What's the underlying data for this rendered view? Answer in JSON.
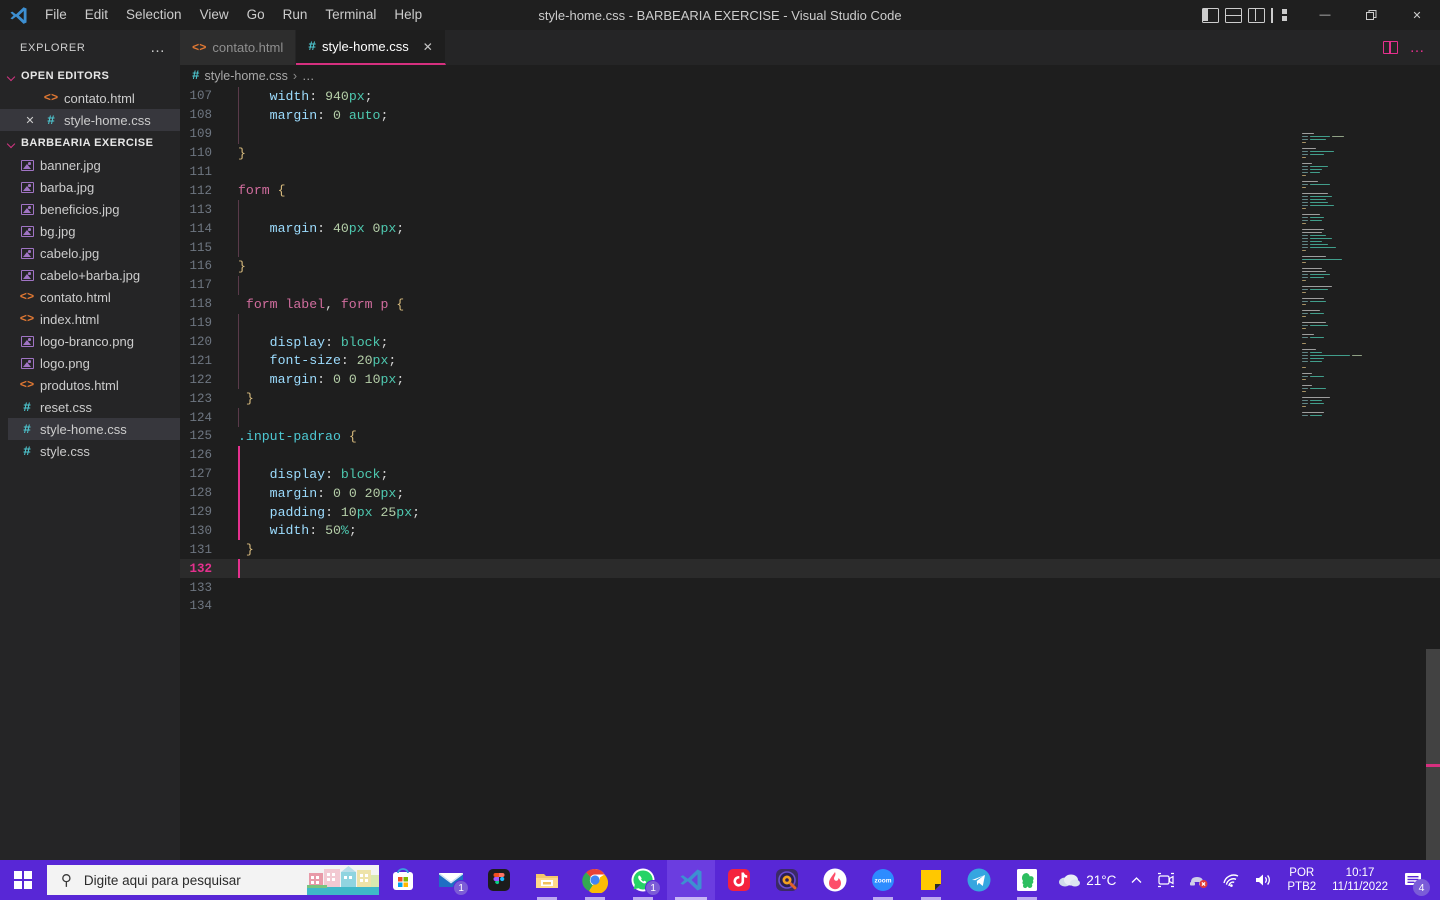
{
  "window": {
    "title": "style-home.css - BARBEARIA EXERCISE - Visual Studio Code",
    "menu": [
      "File",
      "Edit",
      "Selection",
      "View",
      "Go",
      "Run",
      "Terminal",
      "Help"
    ],
    "minimize_label": "—",
    "maximize_label": "❐",
    "close_label": "✕",
    "layout_icons": [
      "toggle-primary-sidebar-icon",
      "toggle-panel-icon",
      "toggle-secondary-sidebar-icon",
      "customize-layout-icon"
    ]
  },
  "sidebar": {
    "header": "EXPLORER",
    "more_actions": "…",
    "open_editors": {
      "label": "OPEN EDITORS",
      "items": [
        {
          "name": "contato.html",
          "icon": "html-file-icon",
          "dirty": false,
          "active": false
        },
        {
          "name": "style-home.css",
          "icon": "css-file-icon",
          "dirty": false,
          "active": true
        }
      ]
    },
    "project": {
      "label": "BARBEARIA EXERCISE",
      "files": [
        {
          "name": "banner.jpg",
          "icon": "image-file-icon"
        },
        {
          "name": "barba.jpg",
          "icon": "image-file-icon"
        },
        {
          "name": "beneficios.jpg",
          "icon": "image-file-icon"
        },
        {
          "name": "bg.jpg",
          "icon": "image-file-icon"
        },
        {
          "name": "cabelo.jpg",
          "icon": "image-file-icon"
        },
        {
          "name": "cabelo+barba.jpg",
          "icon": "image-file-icon"
        },
        {
          "name": "contato.html",
          "icon": "html-file-icon"
        },
        {
          "name": "index.html",
          "icon": "html-file-icon"
        },
        {
          "name": "logo-branco.png",
          "icon": "image-file-icon"
        },
        {
          "name": "logo.png",
          "icon": "image-file-icon"
        },
        {
          "name": "produtos.html",
          "icon": "html-file-icon"
        },
        {
          "name": "reset.css",
          "icon": "css-file-icon"
        },
        {
          "name": "style-home.css",
          "icon": "css-file-icon",
          "selected": true
        },
        {
          "name": "style.css",
          "icon": "css-file-icon"
        }
      ]
    }
  },
  "editor": {
    "tabs": [
      {
        "label": "contato.html",
        "icon": "html-file-icon",
        "active": false
      },
      {
        "label": "style-home.css",
        "icon": "css-file-icon",
        "active": true,
        "close": "✕"
      }
    ],
    "actions": {
      "split_editor": "split-editor-icon",
      "more": "…"
    },
    "breadcrumb": {
      "icon": "css-file-icon",
      "file": "style-home.css",
      "separator": "›",
      "tail": "…"
    },
    "first_line_number": 107,
    "active_line": 132,
    "lines": [
      {
        "n": 107,
        "tokens": [
          {
            "t": "    ",
            "c": "punc"
          },
          {
            "t": "width",
            "c": "prop"
          },
          {
            "t": ": ",
            "c": "punc"
          },
          {
            "t": "940",
            "c": "num"
          },
          {
            "t": "px",
            "c": "val"
          },
          {
            "t": ";",
            "c": "punc"
          }
        ],
        "guide": true
      },
      {
        "n": 108,
        "tokens": [
          {
            "t": "    ",
            "c": "punc"
          },
          {
            "t": "margin",
            "c": "prop"
          },
          {
            "t": ": ",
            "c": "punc"
          },
          {
            "t": "0",
            "c": "num"
          },
          {
            "t": " ",
            "c": "punc"
          },
          {
            "t": "auto",
            "c": "val"
          },
          {
            "t": ";",
            "c": "punc"
          }
        ],
        "guide": true
      },
      {
        "n": 109,
        "tokens": [],
        "guide": true
      },
      {
        "n": 110,
        "tokens": [
          {
            "t": "}",
            "c": "brace"
          }
        ],
        "guide": false
      },
      {
        "n": 111,
        "tokens": [],
        "guide": false
      },
      {
        "n": 112,
        "tokens": [
          {
            "t": "form",
            "c": "sel"
          },
          {
            "t": " ",
            "c": "punc"
          },
          {
            "t": "{",
            "c": "brace"
          }
        ],
        "guide": false
      },
      {
        "n": 113,
        "tokens": [],
        "guide": true
      },
      {
        "n": 114,
        "tokens": [
          {
            "t": "    ",
            "c": "punc"
          },
          {
            "t": "margin",
            "c": "prop"
          },
          {
            "t": ": ",
            "c": "punc"
          },
          {
            "t": "40",
            "c": "num"
          },
          {
            "t": "px",
            "c": "val"
          },
          {
            "t": " ",
            "c": "punc"
          },
          {
            "t": "0",
            "c": "num"
          },
          {
            "t": "px",
            "c": "val"
          },
          {
            "t": ";",
            "c": "punc"
          }
        ],
        "guide": true
      },
      {
        "n": 115,
        "tokens": [],
        "guide": true
      },
      {
        "n": 116,
        "tokens": [
          {
            "t": "}",
            "c": "brace"
          }
        ],
        "guide": false
      },
      {
        "n": 117,
        "tokens": [],
        "guide": true
      },
      {
        "n": 118,
        "tokens": [
          {
            "t": " form label",
            "c": "sel"
          },
          {
            "t": ", ",
            "c": "punc"
          },
          {
            "t": "form p",
            "c": "sel"
          },
          {
            "t": " ",
            "c": "punc"
          },
          {
            "t": "{",
            "c": "brace"
          }
        ],
        "guide": false
      },
      {
        "n": 119,
        "tokens": [],
        "guide": true
      },
      {
        "n": 120,
        "tokens": [
          {
            "t": "    ",
            "c": "punc"
          },
          {
            "t": "display",
            "c": "prop"
          },
          {
            "t": ": ",
            "c": "punc"
          },
          {
            "t": "block",
            "c": "val"
          },
          {
            "t": ";",
            "c": "punc"
          }
        ],
        "guide": true
      },
      {
        "n": 121,
        "tokens": [
          {
            "t": "    ",
            "c": "punc"
          },
          {
            "t": "font-size",
            "c": "prop"
          },
          {
            "t": ": ",
            "c": "punc"
          },
          {
            "t": "20",
            "c": "num"
          },
          {
            "t": "px",
            "c": "val"
          },
          {
            "t": ";",
            "c": "punc"
          }
        ],
        "guide": true
      },
      {
        "n": 122,
        "tokens": [
          {
            "t": "    ",
            "c": "punc"
          },
          {
            "t": "margin",
            "c": "prop"
          },
          {
            "t": ": ",
            "c": "punc"
          },
          {
            "t": "0",
            "c": "num"
          },
          {
            "t": " ",
            "c": "punc"
          },
          {
            "t": "0",
            "c": "num"
          },
          {
            "t": " ",
            "c": "punc"
          },
          {
            "t": "10",
            "c": "num"
          },
          {
            "t": "px",
            "c": "val"
          },
          {
            "t": ";",
            "c": "punc"
          }
        ],
        "guide": true
      },
      {
        "n": 123,
        "tokens": [
          {
            "t": " }",
            "c": "brace"
          }
        ],
        "guide": false
      },
      {
        "n": 124,
        "tokens": [],
        "guide": true
      },
      {
        "n": 125,
        "tokens": [
          {
            "t": ".input-padrao",
            "c": "cls"
          },
          {
            "t": " ",
            "c": "punc"
          },
          {
            "t": "{",
            "c": "brace"
          }
        ],
        "guide": false
      },
      {
        "n": 126,
        "tokens": [],
        "guide": "active"
      },
      {
        "n": 127,
        "tokens": [
          {
            "t": "    ",
            "c": "punc"
          },
          {
            "t": "display",
            "c": "prop"
          },
          {
            "t": ": ",
            "c": "punc"
          },
          {
            "t": "block",
            "c": "val"
          },
          {
            "t": ";",
            "c": "punc"
          }
        ],
        "guide": "active"
      },
      {
        "n": 128,
        "tokens": [
          {
            "t": "    ",
            "c": "punc"
          },
          {
            "t": "margin",
            "c": "prop"
          },
          {
            "t": ": ",
            "c": "punc"
          },
          {
            "t": "0",
            "c": "num"
          },
          {
            "t": " ",
            "c": "punc"
          },
          {
            "t": "0",
            "c": "num"
          },
          {
            "t": " ",
            "c": "punc"
          },
          {
            "t": "20",
            "c": "num"
          },
          {
            "t": "px",
            "c": "val"
          },
          {
            "t": ";",
            "c": "punc"
          }
        ],
        "guide": "active"
      },
      {
        "n": 129,
        "tokens": [
          {
            "t": "    ",
            "c": "punc"
          },
          {
            "t": "padding",
            "c": "prop"
          },
          {
            "t": ": ",
            "c": "punc"
          },
          {
            "t": "10",
            "c": "num"
          },
          {
            "t": "px",
            "c": "val"
          },
          {
            "t": " ",
            "c": "punc"
          },
          {
            "t": "25",
            "c": "num"
          },
          {
            "t": "px",
            "c": "val"
          },
          {
            "t": ";",
            "c": "punc"
          }
        ],
        "guide": "active"
      },
      {
        "n": 130,
        "tokens": [
          {
            "t": "    ",
            "c": "punc"
          },
          {
            "t": "width",
            "c": "prop"
          },
          {
            "t": ": ",
            "c": "punc"
          },
          {
            "t": "50",
            "c": "num"
          },
          {
            "t": "%",
            "c": "val"
          },
          {
            "t": ";",
            "c": "punc"
          }
        ],
        "guide": "active"
      },
      {
        "n": 131,
        "tokens": [
          {
            "t": " }",
            "c": "brace"
          }
        ],
        "guide": false
      },
      {
        "n": 132,
        "tokens": [],
        "guide": "active",
        "current": true
      },
      {
        "n": 133,
        "tokens": [],
        "guide": false
      },
      {
        "n": 134,
        "tokens": [],
        "guide": false
      }
    ]
  },
  "taskbar": {
    "start": "windows-start-icon",
    "search_placeholder": "Digite aqui para pesquisar",
    "apps": [
      {
        "name": "microsoft-store-icon",
        "badge": null,
        "active": false,
        "open": false
      },
      {
        "name": "mail-icon",
        "badge": "1",
        "active": false,
        "open": false
      },
      {
        "name": "figma-icon",
        "badge": null,
        "active": false,
        "open": false
      },
      {
        "name": "file-explorer-icon",
        "badge": null,
        "active": false,
        "open": true
      },
      {
        "name": "google-chrome-icon",
        "badge": null,
        "active": false,
        "open": true
      },
      {
        "name": "whatsapp-icon",
        "badge": "1",
        "active": false,
        "open": true
      },
      {
        "name": "visual-studio-code-icon",
        "badge": null,
        "active": true,
        "open": true
      },
      {
        "name": "tiktok-icon",
        "badge": null,
        "active": false,
        "open": false
      },
      {
        "name": "spotify-like-icon",
        "badge": null,
        "active": false,
        "open": false
      },
      {
        "name": "tinder-icon",
        "badge": null,
        "active": false,
        "open": false
      },
      {
        "name": "zoom-icon",
        "badge": null,
        "active": false,
        "open": true
      },
      {
        "name": "sticky-notes-icon",
        "badge": null,
        "active": false,
        "open": true
      },
      {
        "name": "telegram-icon",
        "badge": null,
        "active": false,
        "open": false
      },
      {
        "name": "evernote-icon",
        "badge": null,
        "active": false,
        "open": true
      }
    ],
    "tray": {
      "weather_icon": "cloud-icon",
      "temperature": "21°C",
      "show_hidden": "chevron-up-icon",
      "icons": [
        "meet-camera-icon",
        "speaker-muted-icon",
        "wifi-icon",
        "volume-icon"
      ],
      "language_line1": "POR",
      "language_line2": "PTB2",
      "time": "10:17",
      "date": "11/11/2022",
      "notifications_icon": "notifications-icon",
      "notifications_count": "4"
    }
  },
  "colors": {
    "accent_pink": "#e5308e",
    "taskbar": "#5827d6",
    "editor_bg": "#1e1e1e",
    "sidebar_bg": "#252526"
  }
}
